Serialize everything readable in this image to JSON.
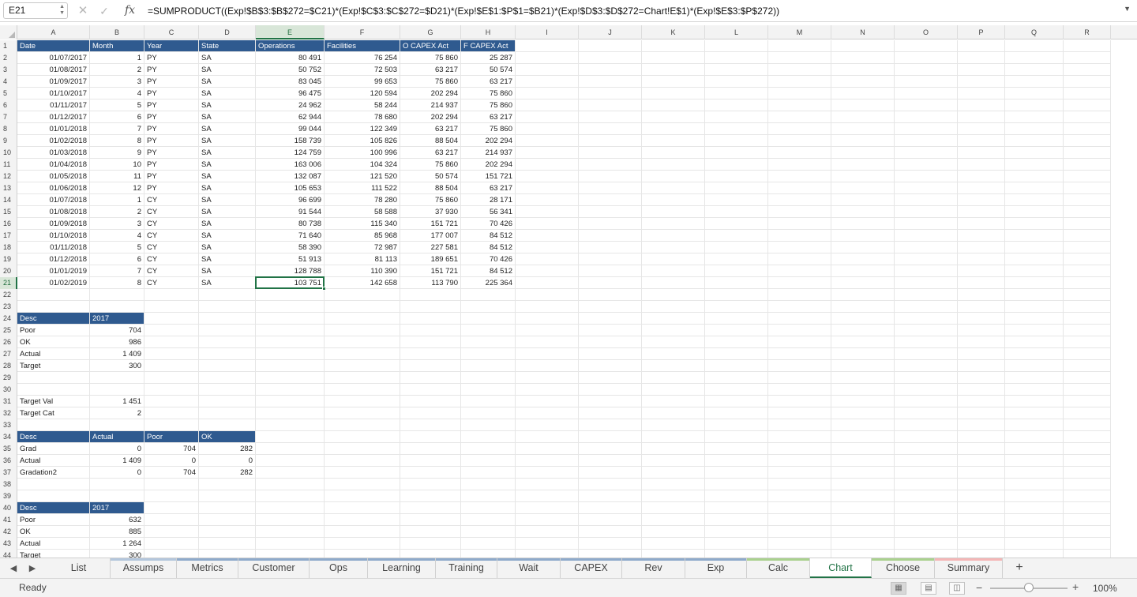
{
  "formula_bar": {
    "name_box": "E21",
    "fx_label": "fx",
    "formula": "=SUMPRODUCT((Exp!$B$3:$B$272=$C21)*(Exp!$C$3:$C$272=$D21)*(Exp!$E$1:$P$1=$B21)*(Exp!$D$3:$D$272=Chart!E$1)*(Exp!$E$3:$P$272))"
  },
  "columns": [
    "A",
    "B",
    "C",
    "D",
    "E",
    "F",
    "G",
    "H",
    "I",
    "J",
    "K",
    "L",
    "M",
    "N",
    "O",
    "P",
    "Q",
    "R"
  ],
  "selected_cell": {
    "col": "E",
    "row": 21
  },
  "header_fill_color": "#2f5a8f",
  "rows": [
    {
      "n": 1,
      "cells": {
        "A": "Date",
        "B": "Month",
        "C": "Year",
        "D": "State",
        "E": "Operations",
        "F": "Facilities",
        "G": "O CAPEX Act",
        "H": "F CAPEX Act"
      },
      "header": [
        "A",
        "B",
        "C",
        "D",
        "E",
        "F",
        "G",
        "H"
      ]
    },
    {
      "n": 2,
      "cells": {
        "A": "01/07/2017",
        "B": "1",
        "C": "PY",
        "D": "SA",
        "E": "80 491",
        "F": "76 254",
        "G": "75 860",
        "H": "25 287"
      }
    },
    {
      "n": 3,
      "cells": {
        "A": "01/08/2017",
        "B": "2",
        "C": "PY",
        "D": "SA",
        "E": "50 752",
        "F": "72 503",
        "G": "63 217",
        "H": "50 574"
      }
    },
    {
      "n": 4,
      "cells": {
        "A": "01/09/2017",
        "B": "3",
        "C": "PY",
        "D": "SA",
        "E": "83 045",
        "F": "99 653",
        "G": "75 860",
        "H": "63 217"
      }
    },
    {
      "n": 5,
      "cells": {
        "A": "01/10/2017",
        "B": "4",
        "C": "PY",
        "D": "SA",
        "E": "96 475",
        "F": "120 594",
        "G": "202 294",
        "H": "75 860"
      }
    },
    {
      "n": 6,
      "cells": {
        "A": "01/11/2017",
        "B": "5",
        "C": "PY",
        "D": "SA",
        "E": "24 962",
        "F": "58 244",
        "G": "214 937",
        "H": "75 860"
      }
    },
    {
      "n": 7,
      "cells": {
        "A": "01/12/2017",
        "B": "6",
        "C": "PY",
        "D": "SA",
        "E": "62 944",
        "F": "78 680",
        "G": "202 294",
        "H": "63 217"
      }
    },
    {
      "n": 8,
      "cells": {
        "A": "01/01/2018",
        "B": "7",
        "C": "PY",
        "D": "SA",
        "E": "99 044",
        "F": "122 349",
        "G": "63 217",
        "H": "75 860"
      }
    },
    {
      "n": 9,
      "cells": {
        "A": "01/02/2018",
        "B": "8",
        "C": "PY",
        "D": "SA",
        "E": "158 739",
        "F": "105 826",
        "G": "88 504",
        "H": "202 294"
      }
    },
    {
      "n": 10,
      "cells": {
        "A": "01/03/2018",
        "B": "9",
        "C": "PY",
        "D": "SA",
        "E": "124 759",
        "F": "100 996",
        "G": "63 217",
        "H": "214 937"
      }
    },
    {
      "n": 11,
      "cells": {
        "A": "01/04/2018",
        "B": "10",
        "C": "PY",
        "D": "SA",
        "E": "163 006",
        "F": "104 324",
        "G": "75 860",
        "H": "202 294"
      }
    },
    {
      "n": 12,
      "cells": {
        "A": "01/05/2018",
        "B": "11",
        "C": "PY",
        "D": "SA",
        "E": "132 087",
        "F": "121 520",
        "G": "50 574",
        "H": "151 721"
      }
    },
    {
      "n": 13,
      "cells": {
        "A": "01/06/2018",
        "B": "12",
        "C": "PY",
        "D": "SA",
        "E": "105 653",
        "F": "111 522",
        "G": "88 504",
        "H": "63 217"
      }
    },
    {
      "n": 14,
      "cells": {
        "A": "01/07/2018",
        "B": "1",
        "C": "CY",
        "D": "SA",
        "E": "96 699",
        "F": "78 280",
        "G": "75 860",
        "H": "28 171"
      }
    },
    {
      "n": 15,
      "cells": {
        "A": "01/08/2018",
        "B": "2",
        "C": "CY",
        "D": "SA",
        "E": "91 544",
        "F": "58 588",
        "G": "37 930",
        "H": "56 341"
      }
    },
    {
      "n": 16,
      "cells": {
        "A": "01/09/2018",
        "B": "3",
        "C": "CY",
        "D": "SA",
        "E": "80 738",
        "F": "115 340",
        "G": "151 721",
        "H": "70 426"
      }
    },
    {
      "n": 17,
      "cells": {
        "A": "01/10/2018",
        "B": "4",
        "C": "CY",
        "D": "SA",
        "E": "71 640",
        "F": "85 968",
        "G": "177 007",
        "H": "84 512"
      }
    },
    {
      "n": 18,
      "cells": {
        "A": "01/11/2018",
        "B": "5",
        "C": "CY",
        "D": "SA",
        "E": "58 390",
        "F": "72 987",
        "G": "227 581",
        "H": "84 512"
      }
    },
    {
      "n": 19,
      "cells": {
        "A": "01/12/2018",
        "B": "6",
        "C": "CY",
        "D": "SA",
        "E": "51 913",
        "F": "81 113",
        "G": "189 651",
        "H": "70 426"
      }
    },
    {
      "n": 20,
      "cells": {
        "A": "01/01/2019",
        "B": "7",
        "C": "CY",
        "D": "SA",
        "E": "128 788",
        "F": "110 390",
        "G": "151 721",
        "H": "84 512"
      }
    },
    {
      "n": 21,
      "cells": {
        "A": "01/02/2019",
        "B": "8",
        "C": "CY",
        "D": "SA",
        "E": "103 751",
        "F": "142 658",
        "G": "113 790",
        "H": "225 364"
      }
    },
    {
      "n": 22,
      "cells": {}
    },
    {
      "n": 23,
      "cells": {}
    },
    {
      "n": 24,
      "cells": {
        "A": "Desc",
        "B": "2017"
      },
      "header": [
        "A",
        "B"
      ]
    },
    {
      "n": 25,
      "cells": {
        "A": "Poor",
        "B": "704"
      }
    },
    {
      "n": 26,
      "cells": {
        "A": "OK",
        "B": "986"
      }
    },
    {
      "n": 27,
      "cells": {
        "A": "Actual",
        "B": "1 409"
      }
    },
    {
      "n": 28,
      "cells": {
        "A": "Target",
        "B": "300"
      }
    },
    {
      "n": 29,
      "cells": {}
    },
    {
      "n": 30,
      "cells": {}
    },
    {
      "n": 31,
      "cells": {
        "A": "Target Val",
        "B": "1 451"
      }
    },
    {
      "n": 32,
      "cells": {
        "A": "Target Cat",
        "B": "2"
      }
    },
    {
      "n": 33,
      "cells": {}
    },
    {
      "n": 34,
      "cells": {
        "A": "Desc",
        "B": "Actual",
        "C": "Poor",
        "D": "OK"
      },
      "header": [
        "A",
        "B",
        "C",
        "D"
      ]
    },
    {
      "n": 35,
      "cells": {
        "A": "Grad",
        "B": "0",
        "C": "704",
        "D": "282"
      }
    },
    {
      "n": 36,
      "cells": {
        "A": "Actual",
        "B": "1 409",
        "C": "0",
        "D": "0"
      }
    },
    {
      "n": 37,
      "cells": {
        "A": "Gradation2",
        "B": "0",
        "C": "704",
        "D": "282"
      }
    },
    {
      "n": 38,
      "cells": {}
    },
    {
      "n": 39,
      "cells": {}
    },
    {
      "n": 40,
      "cells": {
        "A": "Desc",
        "B": "2017"
      },
      "header": [
        "A",
        "B"
      ]
    },
    {
      "n": 41,
      "cells": {
        "A": "Poor",
        "B": "632"
      }
    },
    {
      "n": 42,
      "cells": {
        "A": "OK",
        "B": "885"
      }
    },
    {
      "n": 43,
      "cells": {
        "A": "Actual",
        "B": "1 264"
      }
    },
    {
      "n": 44,
      "cells": {
        "A": "Target",
        "B": "300"
      }
    }
  ],
  "tabs": [
    {
      "label": "List",
      "color": ""
    },
    {
      "label": "Assumps",
      "color": "#b3c6dc"
    },
    {
      "label": "Metrics",
      "color": "#8eaacb"
    },
    {
      "label": "Customer",
      "color": "#8eaacb"
    },
    {
      "label": "Ops",
      "color": "#8eaacb"
    },
    {
      "label": "Learning",
      "color": "#8eaacb"
    },
    {
      "label": "Training",
      "color": "#8eaacb"
    },
    {
      "label": "Wait",
      "color": "#8eaacb"
    },
    {
      "label": "CAPEX",
      "color": "#8eaacb"
    },
    {
      "label": "Rev",
      "color": "#8eaacb"
    },
    {
      "label": "Exp",
      "color": "#8eaacb"
    },
    {
      "label": "Calc",
      "color": "#a9d18e"
    },
    {
      "label": "Chart",
      "color": "",
      "active": true
    },
    {
      "label": "Choose",
      "color": "#a9d18e"
    },
    {
      "label": "Summary",
      "color": "#f4b6b6"
    }
  ],
  "status": {
    "text": "Ready",
    "zoom": "100%"
  }
}
